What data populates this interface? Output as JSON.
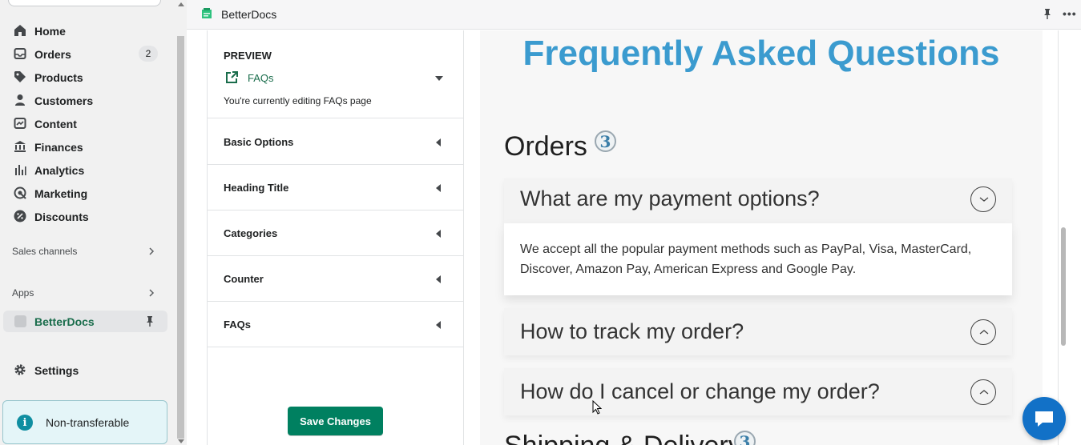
{
  "nav": {
    "items": [
      {
        "label": "Home",
        "icon": "home-icon"
      },
      {
        "label": "Orders",
        "icon": "orders-icon",
        "count": "2"
      },
      {
        "label": "Products",
        "icon": "tag-icon"
      },
      {
        "label": "Customers",
        "icon": "person-icon"
      },
      {
        "label": "Content",
        "icon": "content-icon"
      },
      {
        "label": "Finances",
        "icon": "bank-icon"
      },
      {
        "label": "Analytics",
        "icon": "bar-chart-icon"
      },
      {
        "label": "Marketing",
        "icon": "target-icon"
      },
      {
        "label": "Discounts",
        "icon": "discount-icon"
      }
    ],
    "sales_channels": "Sales channels",
    "apps": "Apps",
    "app_item": "BetterDocs",
    "settings": "Settings",
    "non_transferable": "Non-transferable"
  },
  "topbar": {
    "title": "BetterDocs",
    "more": "•••"
  },
  "panel": {
    "preview_heading": "PREVIEW",
    "selected_page": "FAQs",
    "editing_note": "You're currently editing FAQs page",
    "sections": [
      "Basic Options",
      "Heading Title",
      "Categories",
      "Counter",
      "FAQs"
    ],
    "save_label": "Save Changes"
  },
  "faq": {
    "title": "Frequently Asked Questions",
    "categories": [
      {
        "name": "Orders",
        "count": "3",
        "questions": [
          {
            "q": "What are my payment options?",
            "expanded": true,
            "a": "We accept all the popular payment methods such as PayPal, Visa, MasterCard, Discover, Amazon Pay, American Express and Google Pay."
          },
          {
            "q": "How to track my order?",
            "expanded": false
          },
          {
            "q": "How do I cancel or change my order?",
            "expanded": false
          }
        ]
      },
      {
        "name": "Shipping & Delivery",
        "count": "3"
      }
    ]
  },
  "colors": {
    "accent_green": "#008060",
    "faq_title_blue": "#3b9bcf",
    "chat_blue": "#1271c7"
  }
}
